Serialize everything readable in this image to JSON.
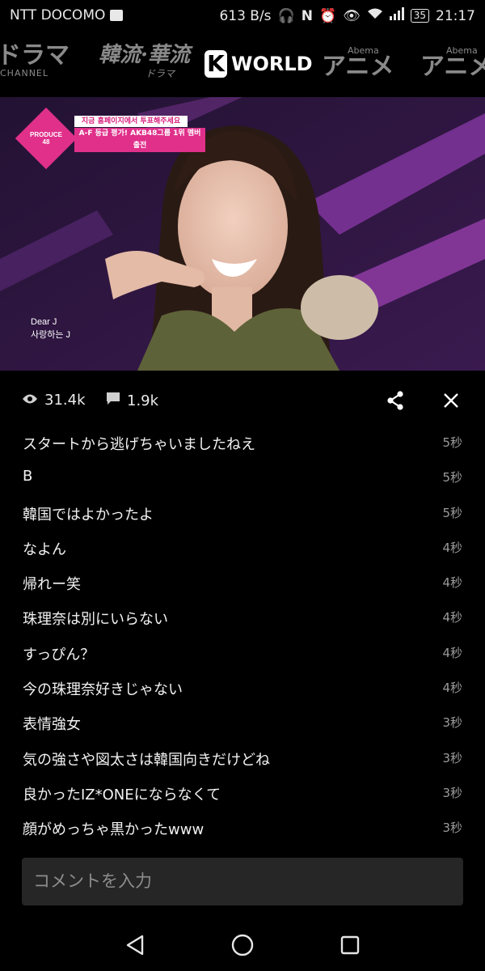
{
  "status_bar": {
    "carrier": "NTT DOCOMO",
    "speed": "613 B/s",
    "battery": "35",
    "time": "21:17"
  },
  "channels": [
    {
      "label": "ドラマ",
      "sub": "CHANNEL"
    },
    {
      "label": "韓流·華流",
      "sub": "ドラマ"
    },
    {
      "label": "WORLD",
      "badge": "K"
    },
    {
      "label": "アニメ",
      "sub": "Abema"
    },
    {
      "label": "アニメ",
      "sub": "Abema"
    }
  ],
  "video": {
    "logo_text": "PRODUCE 48",
    "banner_top": "지금 홈페이지에서 투표해주세요",
    "banner_main": "A-F 등급 평가! AKB48그룹 1위 멤버 출전",
    "caption_line1": "Dear J",
    "caption_line2": "사랑하는 J"
  },
  "stats": {
    "views": "31.4k",
    "comments": "1.9k"
  },
  "comments": [
    {
      "text": "スタートから逃げちゃいましたねえ",
      "time": "5秒"
    },
    {
      "text": "B",
      "time": "5秒"
    },
    {
      "text": "韓国ではよかったよ",
      "time": "5秒"
    },
    {
      "text": "なよん",
      "time": "4秒"
    },
    {
      "text": "帰れー笑",
      "time": "4秒"
    },
    {
      "text": "珠理奈は別にいらない",
      "time": "4秒"
    },
    {
      "text": "すっぴん？",
      "time": "4秒"
    },
    {
      "text": "今の珠理奈好きじゃない",
      "time": "4秒"
    },
    {
      "text": "表情強女",
      "time": "3秒"
    },
    {
      "text": "気の強さや図太さは韓国向きだけどね",
      "time": "3秒"
    },
    {
      "text": "良かったIZ*ONEにならなくて",
      "time": "3秒"
    },
    {
      "text": "顔がめっちゃ黒かったwww",
      "time": "3秒"
    }
  ],
  "comment_input": {
    "placeholder": "コメントを入力"
  }
}
